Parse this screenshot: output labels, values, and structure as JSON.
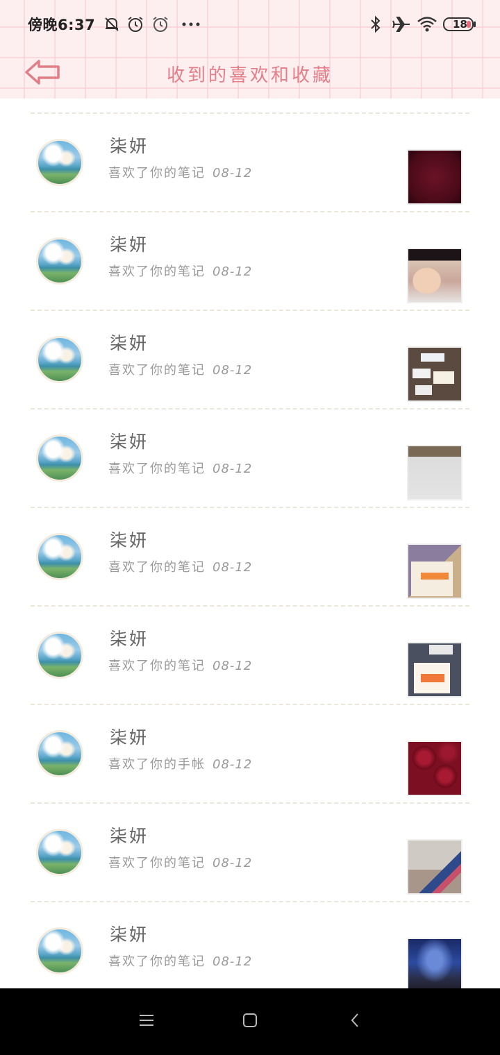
{
  "status_bar": {
    "time": "傍晚6:37",
    "battery": "18",
    "icons": [
      "mute-icon",
      "alarm-icon",
      "alarm-icon",
      "more-icon",
      "bluetooth-icon",
      "airplane-icon",
      "wifi-icon",
      "battery-icon"
    ]
  },
  "header": {
    "title": "收到的喜欢和收藏",
    "back_icon": "back-arrow-icon"
  },
  "items": [
    {
      "name": "柒妍",
      "action": "喜欢了你的笔记",
      "date": "08-12",
      "thumb": "dark-red-texture"
    },
    {
      "name": "柒妍",
      "action": "喜欢了你的笔记",
      "date": "08-12",
      "thumb": "selfie"
    },
    {
      "name": "柒妍",
      "action": "喜欢了你的笔记",
      "date": "08-12",
      "thumb": "cards-on-table"
    },
    {
      "name": "柒妍",
      "action": "喜欢了你的笔记",
      "date": "08-12",
      "thumb": "white-board"
    },
    {
      "name": "柒妍",
      "action": "喜欢了你的笔记",
      "date": "08-12",
      "thumb": "sticker-card"
    },
    {
      "name": "柒妍",
      "action": "喜欢了你的笔记",
      "date": "08-12",
      "thumb": "stickers-book"
    },
    {
      "name": "柒妍",
      "action": "喜欢了你的手帐",
      "date": "08-12",
      "thumb": "red-roses"
    },
    {
      "name": "柒妍",
      "action": "喜欢了你的笔记",
      "date": "08-12",
      "thumb": "room-photo"
    },
    {
      "name": "柒妍",
      "action": "喜欢了你的笔记",
      "date": "08-12",
      "thumb": "starry-sky"
    }
  ],
  "nav_bar": {
    "icons": [
      "menu-icon",
      "home-icon",
      "back-icon"
    ]
  },
  "colors": {
    "title": "#e27e88",
    "header_bg": "#fdeef0",
    "divider": "#ece7dd"
  }
}
